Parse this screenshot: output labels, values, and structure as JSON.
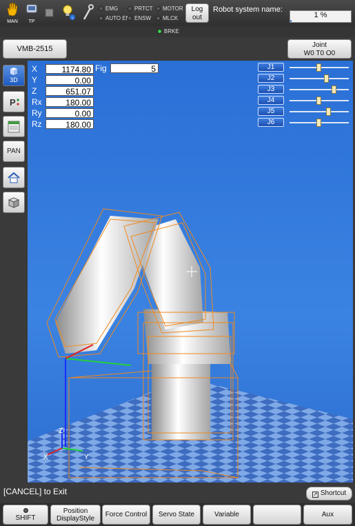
{
  "topbar": {
    "man_label": "MAN",
    "tp_label": "TP",
    "status_left": [
      {
        "label": "EMG",
        "on": false
      },
      {
        "label": "AUTO EN",
        "on": false
      }
    ],
    "status_mid": [
      {
        "label": "PRTCT",
        "on": false
      },
      {
        "label": "ENSW",
        "on": false
      }
    ],
    "status_right": [
      {
        "label": "MOTOR",
        "on": false
      },
      {
        "label": "MLCK",
        "on": false
      }
    ],
    "logout_line1": "Log",
    "logout_line2": "out",
    "robot_system_name_label": "Robot system name:",
    "speed_percent": "1 %",
    "speed_value": 1
  },
  "subbar": {
    "brke_label": "BRKE",
    "brke_on": true
  },
  "toolbar": {
    "model_label": "VMB-2515",
    "joint_line1": "Joint",
    "joint_line2": "W0 T0 O0"
  },
  "left_tools": [
    {
      "label": "3D",
      "icon": "3d-view-icon",
      "active": true
    },
    {
      "label": "P",
      "icon": "point-icon",
      "active": false
    },
    {
      "label": "",
      "icon": "panel-icon",
      "active": false
    },
    {
      "label": "PAN",
      "icon": "pan-icon",
      "active": false
    },
    {
      "label": "",
      "icon": "home-icon",
      "active": false
    },
    {
      "label": "",
      "icon": "box-view-icon",
      "active": false
    }
  ],
  "position": {
    "rows": [
      {
        "key": "X",
        "value": "1174.80"
      },
      {
        "key": "Y",
        "value": "0.00"
      },
      {
        "key": "Z",
        "value": "651.07"
      },
      {
        "key": "Rx",
        "value": "180.00"
      },
      {
        "key": "Ry",
        "value": "0.00"
      },
      {
        "key": "Rz",
        "value": "180.00"
      }
    ],
    "fig_label": "Fig",
    "fig_value": "5"
  },
  "joints": [
    {
      "label": "J1",
      "level": 0.5
    },
    {
      "label": "J2",
      "level": 0.63
    },
    {
      "label": "J3",
      "level": 0.76
    },
    {
      "label": "J4",
      "level": 0.5
    },
    {
      "label": "J5",
      "level": 0.66
    },
    {
      "label": "J6",
      "level": 0.5
    }
  ],
  "axes": {
    "x": "X",
    "y": "Y",
    "z": "Z"
  },
  "cancel_text": "[CANCEL] to Exit",
  "shortcut_label": "Shortcut",
  "bottom": {
    "shift": "SHIFT",
    "position_display_line1": "Position",
    "position_display_line2": "DisplayStyle",
    "force_control": "Force Control",
    "servo_state": "Servo State",
    "variable": "Variable",
    "blank": "",
    "aux": "Aux"
  },
  "colors": {
    "viewport": "#3b83e2",
    "wire": "#f08a1e",
    "active_tool": "#1f5cc0",
    "floor_light": "#7fa9e6",
    "floor_dark": "#3d6cc0"
  }
}
